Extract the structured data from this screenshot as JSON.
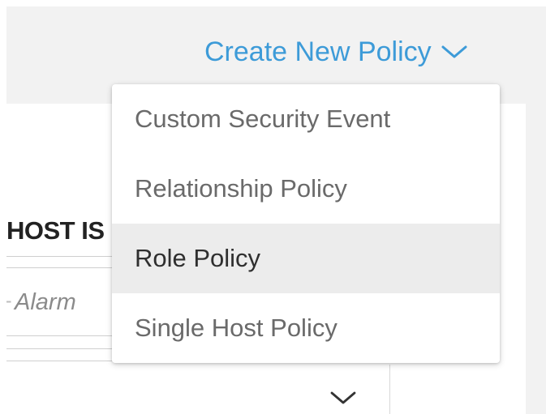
{
  "header": {
    "create_policy_label": "Create New Policy"
  },
  "dropdown": {
    "items": [
      {
        "label": "Custom Security Event",
        "selected": false
      },
      {
        "label": "Relationship Policy",
        "selected": false
      },
      {
        "label": "Role Policy",
        "selected": true
      },
      {
        "label": "Single Host Policy",
        "selected": false
      }
    ]
  },
  "background": {
    "partial_heading": "HOST IS",
    "alarm_text": "Alarm",
    "alarm_prefix": "+"
  },
  "icons": {
    "header_chevron": "chevron-down-icon",
    "bottom_chevron": "chevron-down-icon"
  },
  "colors": {
    "accent": "#3d9bd8",
    "menu_active_bg": "#ececec",
    "app_bg": "#f2f2f2"
  }
}
